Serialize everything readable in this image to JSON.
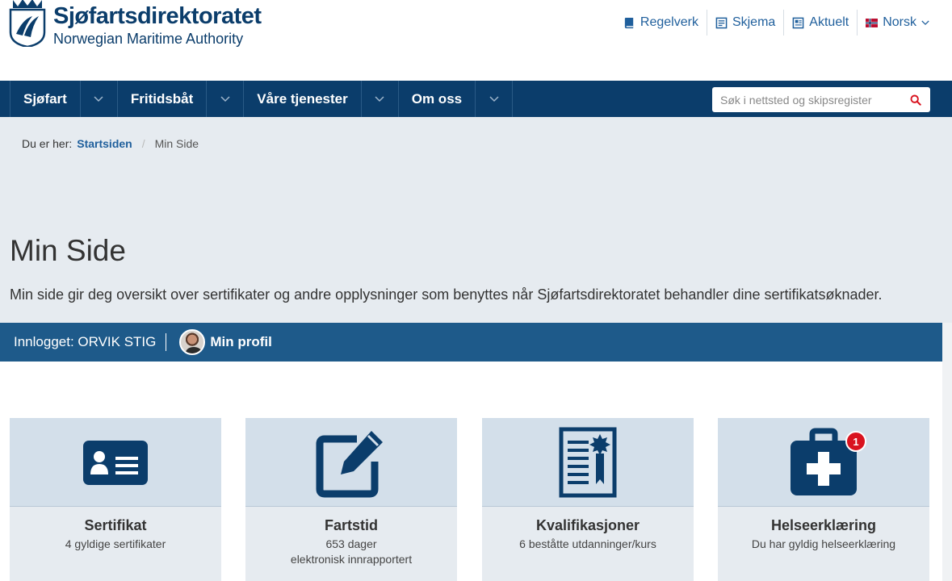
{
  "header": {
    "logo_title": "Sjøfartsdirektoratet",
    "logo_subtitle": "Norwegian Maritime Authority",
    "links": [
      {
        "label": "Regelverk",
        "icon": "book-icon"
      },
      {
        "label": "Skjema",
        "icon": "form-icon"
      },
      {
        "label": "Aktuelt",
        "icon": "news-icon"
      },
      {
        "label": "Norsk",
        "icon": "norway-flag-icon"
      }
    ]
  },
  "nav": {
    "items": [
      "Sjøfart",
      "Fritidsbåt",
      "Våre tjenester",
      "Om oss"
    ],
    "search_placeholder": "Søk i nettsted og skipsregister"
  },
  "breadcrumb": {
    "prefix": "Du er her:",
    "home": "Startsiden",
    "current": "Min Side"
  },
  "page": {
    "title": "Min Side",
    "intro": "Min side gir deg oversikt over sertifikater og andre opplysninger som benyttes når Sjøfartsdirektoratet behandler dine sertifikatsøknader."
  },
  "profile": {
    "logged_in": "Innlogget: ORVIK STIG",
    "profile_link": "Min profil"
  },
  "cards": [
    {
      "title": "Sertifikat",
      "subtitle": "4 gyldige sertifikater",
      "subtitle2": "",
      "icon": "id-card-icon"
    },
    {
      "title": "Fartstid",
      "subtitle": "653 dager",
      "subtitle2": "elektronisk innrapportert",
      "icon": "edit-icon"
    },
    {
      "title": "Kvalifikasjoner",
      "subtitle": "6 beståtte utdanninger/kurs",
      "subtitle2": "",
      "icon": "diploma-icon"
    },
    {
      "title": "Helseerklæring",
      "subtitle": "Du har gyldig helseerklæring",
      "subtitle2": "",
      "icon": "medical-kit-icon",
      "badge": "1"
    }
  ],
  "colors": {
    "brand": "#0b3d6b",
    "profile_bar": "#1e5a8a",
    "badge": "#d9131f"
  }
}
